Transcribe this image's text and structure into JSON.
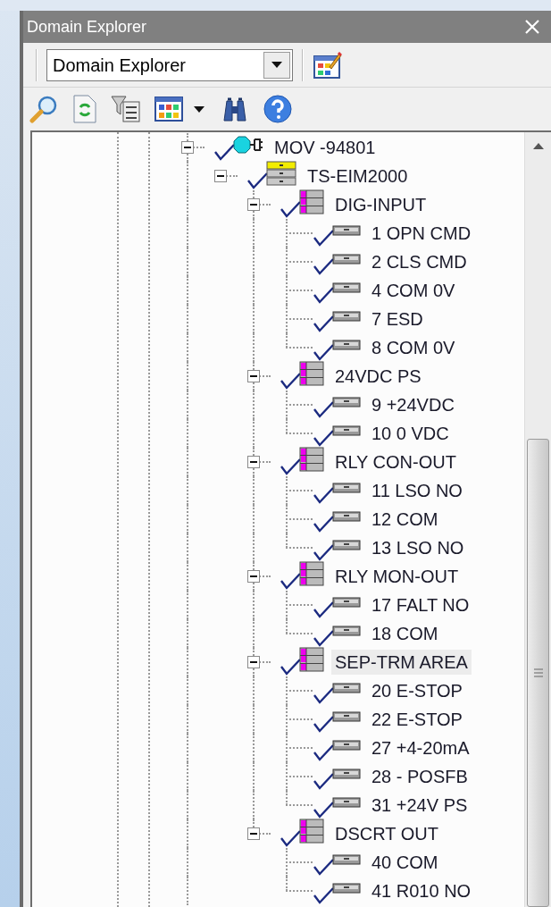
{
  "window": {
    "title": "Domain Explorer"
  },
  "toolbar": {
    "view_select": {
      "value": "Domain Explorer"
    }
  },
  "tree": [
    {
      "label": "MOV -94801",
      "kind": "device",
      "checked": true,
      "expanded": true,
      "selected": false,
      "children": [
        {
          "label": "TS-EIM2000",
          "kind": "module",
          "checked": true,
          "expanded": true,
          "selected": false,
          "children": [
            {
              "label": "DIG-INPUT",
              "kind": "group",
              "checked": true,
              "expanded": true,
              "selected": false,
              "children": [
                {
                  "label": "1 OPN CMD",
                  "kind": "point",
                  "checked": true,
                  "selected": false
                },
                {
                  "label": "2 CLS CMD",
                  "kind": "point",
                  "checked": true,
                  "selected": false
                },
                {
                  "label": "4 COM 0V",
                  "kind": "point",
                  "checked": true,
                  "selected": false
                },
                {
                  "label": "7 ESD",
                  "kind": "point",
                  "checked": true,
                  "selected": false
                },
                {
                  "label": "8 COM 0V",
                  "kind": "point",
                  "checked": true,
                  "selected": false
                }
              ]
            },
            {
              "label": "24VDC PS",
              "kind": "group",
              "checked": true,
              "expanded": true,
              "selected": false,
              "children": [
                {
                  "label": "9 +24VDC",
                  "kind": "point",
                  "checked": true,
                  "selected": false
                },
                {
                  "label": "10 0 VDC",
                  "kind": "point",
                  "checked": true,
                  "selected": false
                }
              ]
            },
            {
              "label": "RLY CON-OUT",
              "kind": "group",
              "checked": true,
              "expanded": true,
              "selected": false,
              "children": [
                {
                  "label": "11 LSO NO",
                  "kind": "point",
                  "checked": true,
                  "selected": false
                },
                {
                  "label": "12 COM",
                  "kind": "point",
                  "checked": true,
                  "selected": false
                },
                {
                  "label": "13 LSO NO",
                  "kind": "point",
                  "checked": true,
                  "selected": false
                }
              ]
            },
            {
              "label": "RLY MON-OUT",
              "kind": "group",
              "checked": true,
              "expanded": true,
              "selected": false,
              "children": [
                {
                  "label": "17 FALT NO",
                  "kind": "point",
                  "checked": true,
                  "selected": false
                },
                {
                  "label": "18 COM",
                  "kind": "point",
                  "checked": true,
                  "selected": false
                }
              ]
            },
            {
              "label": "SEP-TRM AREA",
              "kind": "group",
              "checked": true,
              "expanded": true,
              "selected": true,
              "children": [
                {
                  "label": "20 E-STOP",
                  "kind": "point",
                  "checked": true,
                  "selected": false
                },
                {
                  "label": "22 E-STOP",
                  "kind": "point",
                  "checked": true,
                  "selected": false
                },
                {
                  "label": "27 +4-20mA",
                  "kind": "point",
                  "checked": true,
                  "selected": false
                },
                {
                  "label": "28 - POSFB",
                  "kind": "point",
                  "checked": true,
                  "selected": false
                },
                {
                  "label": "31 +24V PS",
                  "kind": "point",
                  "checked": true,
                  "selected": false
                }
              ]
            },
            {
              "label": "DSCRT OUT",
              "kind": "group",
              "checked": true,
              "expanded": true,
              "selected": false,
              "children": [
                {
                  "label": "40 COM",
                  "kind": "point",
                  "checked": true,
                  "selected": false
                },
                {
                  "label": "41 R010 NO",
                  "kind": "point",
                  "checked": true,
                  "selected": false
                }
              ]
            }
          ]
        }
      ]
    }
  ]
}
